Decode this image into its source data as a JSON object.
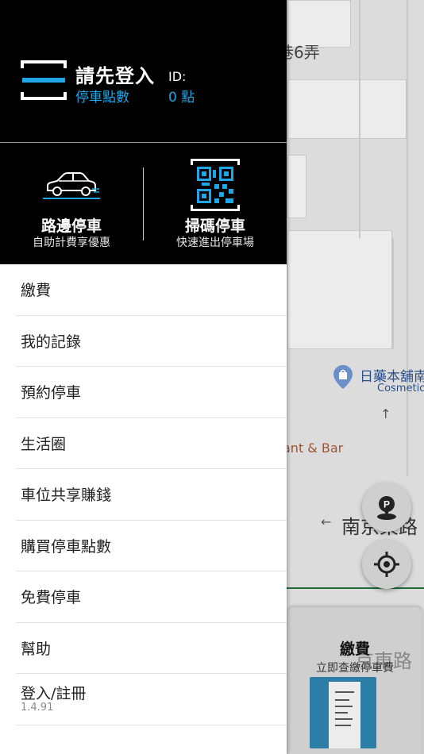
{
  "map": {
    "lane_label": "巷6弄",
    "shop_label": "日藥本舖南",
    "shop_sub": "Cosmetic",
    "restaurant_label": "ant & Bar",
    "road_label": "南京東路",
    "road_label_faded": "京東路",
    "pay_card": {
      "title": "繳費",
      "subtitle": "立即查繳停車費"
    }
  },
  "header": {
    "title": "請先登入",
    "id_label": "ID:",
    "points_label": "停車點數",
    "points_value": "0 點"
  },
  "quick_actions": [
    {
      "title": "路邊停車",
      "subtitle": "自助計費享優惠",
      "icon": "car-icon"
    },
    {
      "title": "掃碼停車",
      "subtitle": "快速進出停車場",
      "icon": "qr-code-icon"
    }
  ],
  "menu": {
    "items": [
      {
        "label": "繳費"
      },
      {
        "label": "我的記錄"
      },
      {
        "label": "預約停車"
      },
      {
        "label": "生活圈"
      },
      {
        "label": "車位共享賺錢"
      },
      {
        "label": "購買停車點數"
      },
      {
        "label": "免費停車"
      },
      {
        "label": "幫助"
      },
      {
        "label": "登入/註冊"
      }
    ],
    "version": "1.4.91"
  },
  "colors": {
    "accent": "#1fa6e6",
    "header_bg": "#000000"
  }
}
